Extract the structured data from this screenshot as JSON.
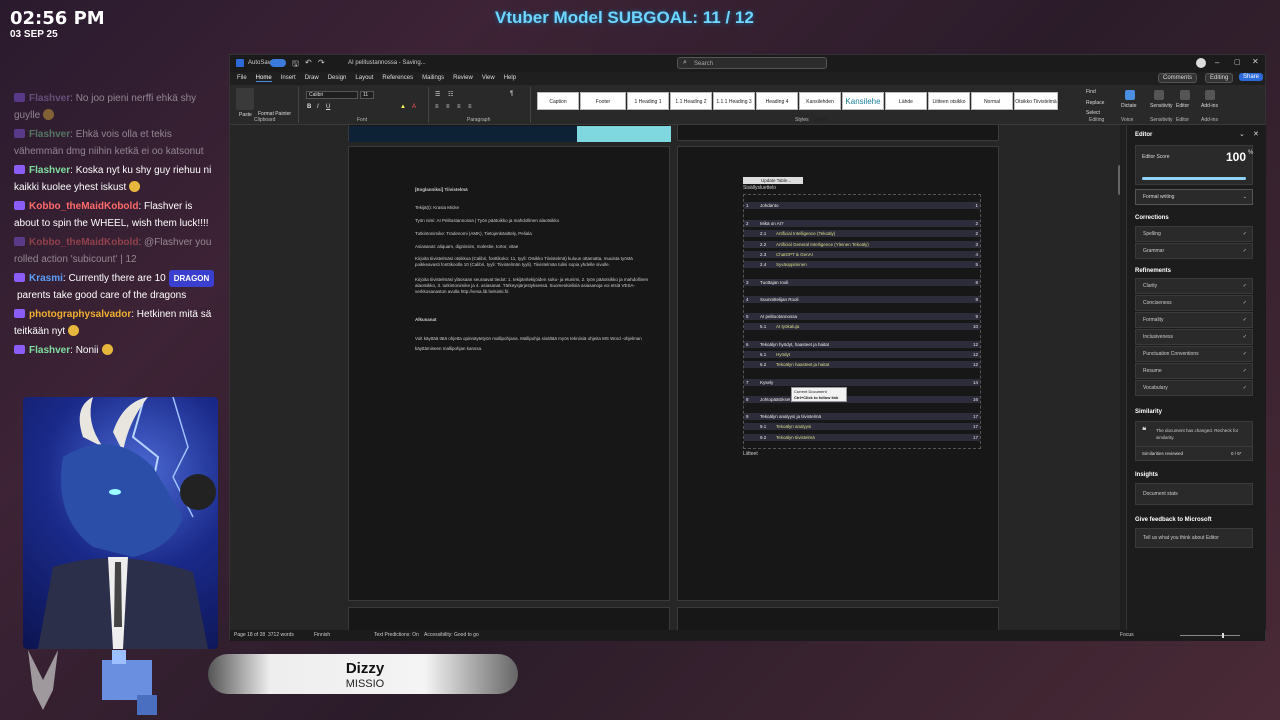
{
  "overlay": {
    "clock": "02:56 PM",
    "date": "03 SEP 25",
    "subgoal": "Vtuber Model SUBGOAL: 11 / 12",
    "nameplate_name": "Dizzy",
    "nameplate_sub": "MISSIO"
  },
  "chat": [
    {
      "user": "Flashver",
      "color": "#a58cd6",
      "text": ": No joo pieni nerffi ehkä shy guylle",
      "faded": true
    },
    {
      "user": "Flashver",
      "color": "#7fe0a0",
      "text": ": Ehkä vois olla et tekis vähemmän dmg niihin ketkä ei oo katsonut",
      "faded": true
    },
    {
      "user": "Flashver",
      "color": "#7fe0a0",
      "text": ": Koska nyt ku shy guy riehuu ni kaikki kuolee yhest iskust"
    },
    {
      "user": "Kobbo_theMaidKobold",
      "color": "#ff6a6a",
      "text": ": Flashver is about to spin the WHEEL, wish them luck!!!!"
    },
    {
      "user": "Kobbo_theMaidKobold",
      "color": "#ff6a6a",
      "text": ": @Flashver you rolled action 'subicount' | 12",
      "faded": true
    },
    {
      "user": "Krasmi",
      "color": "#5aa0ff",
      "text": ": Currently there are 10",
      "badge": "DRAGON",
      "text2": "parents",
      "text3": "take good care of the dragons"
    },
    {
      "user": "photographysalvador",
      "color": "#f0b030",
      "text": ": Hetkinen mitä sä teitkään nyt"
    },
    {
      "user": "Flashver",
      "color": "#7fe0a0",
      "text": ": Nonii"
    }
  ],
  "word": {
    "title": "AI pelitustannossa - Saving...",
    "autosave": "AutoSave",
    "search_placeholder": "Search",
    "menu": [
      "File",
      "Home",
      "Insert",
      "Draw",
      "Design",
      "Layout",
      "References",
      "Mailings",
      "Review",
      "View",
      "Help"
    ],
    "comments": "Comments",
    "editing": "Editing",
    "share": "Share",
    "clipboard": {
      "paste": "Paste",
      "format_painter": "Format Painter",
      "label": "Clipboard"
    },
    "font": {
      "name": "Calibri",
      "size": "11",
      "label": "Font"
    },
    "paragraph_label": "Paragraph",
    "styles_label": "Styles",
    "styles": [
      "Caption",
      "Footer",
      "1 Heading 1",
      "1.1 Heading 2",
      "1.1.1 Heading 3",
      "Heading 4",
      "Kansilehden Otsikko",
      "Kansilehe",
      "Lähde",
      "Liitteen otsikko",
      "Normal",
      "Otsikko Tiivistelmä"
    ],
    "editing_group": {
      "find": "Find",
      "replace": "Replace",
      "select": "Select",
      "label": "Editing"
    },
    "ribbon_right": [
      "Dictate",
      "Sensitivity",
      "Editor",
      "Add-ins"
    ],
    "ribbon_right_labels": [
      "Voice",
      "Sensitivity",
      "Editor",
      "Add-ins"
    ],
    "page1": {
      "heading": "[Englanniksi] Tiivistelmä",
      "authors": "Tekijä(t): Krasia Micke",
      "title_line": "Työn nimi: AI Pelitustannossa | Työn päätoikko ja mahdollinen alaotsikko",
      "degree": "Tutkintonimike: Tradenomi (AMK), Tietojenkäsittely, Peliala",
      "keywords": "Asiasanat: aliquam, dignissim, molestie, tortor, vitae",
      "para1": "Kirjoita tiivistelmäsi otsikkoa (Calibri, fonttikoko: 11, tyyli: Otsikko Tiivistelmä) kuluun ottamatta, muuista työstä poikkeavasti fonttikoolla 10 (Calibri, tyyli: Tiivistelmän tyyli). Tiivistelmän tulisi sopia yhdelle sivulle.",
      "para2": "Kirjoita tiivistelmäsi yläosaan seuraavat tiedot: 1. tekijän/tekijöiden suku- ja etunimi, 2. työn pääotsikko ja mahdollinen alaotsikko, 3. tutkintonimike ja 4. asiasanat. Tärkeysjärjestyksessä. Suomenkielisiä asiasanoja voi etsiä VESA-verkkosanaston avulla http://vesa.lib.helsinki.fi/.",
      "section": "Alkusanat",
      "para3": "Voit käyttää tätä ohjetta opinnäytetyön mallipohjana. Mallipohja sisältää myös tekniisiä ohjeita MS Word -ohjelman käyttämiseen mallipohjan kanssa."
    },
    "page2": {
      "update_btn": "Update Table...",
      "toc_title": "Sisällysluettelo",
      "toc": [
        {
          "n": "1",
          "t": "Johdanto",
          "p": "1"
        },
        {
          "n": "2",
          "t": "Mikä on AI?",
          "p": "2"
        },
        {
          "n": "2.1",
          "t": "Artificial Intelligence (Tekoäly)",
          "p": "2"
        },
        {
          "n": "2.2",
          "t": "Artificial General Intelligence (Yleinen Tekoäly)",
          "p": "3"
        },
        {
          "n": "2.3",
          "t": "ChatGPT & GenAI",
          "p": "4"
        },
        {
          "n": "2.4",
          "t": "Syväoppiminen",
          "p": "5"
        },
        {
          "n": "3",
          "t": "Tuottajan rooli",
          "p": "8"
        },
        {
          "n": "4",
          "t": "Suunnittelijan Rooli",
          "p": "8"
        },
        {
          "n": "5",
          "t": "AI pelituotannossa",
          "p": "9"
        },
        {
          "n": "5.1",
          "t": "AI työkaluja",
          "p": "10"
        },
        {
          "n": "6",
          "t": "Tekoälyn hyödyt, haasteet ja haitat",
          "p": "12"
        },
        {
          "n": "6.1",
          "t": "Hyödyt",
          "p": "12"
        },
        {
          "n": "6.2",
          "t": "Tekoälyn haasteet ja haitat",
          "p": "12"
        },
        {
          "n": "7",
          "t": "Kysely",
          "p": "14"
        },
        {
          "n": "8",
          "t": "Johtopäätökset",
          "p": "16"
        },
        {
          "n": "9",
          "t": "Tekoälyn analyysi ja tiivistelmä",
          "p": "17"
        },
        {
          "n": "9.1",
          "t": "Tekoälyn analyysi",
          "p": "17"
        },
        {
          "n": "9.2",
          "t": "Tekoälyn tiivistelmä",
          "p": "17"
        }
      ],
      "tooltip_title": "Current Document",
      "tooltip_text": "Ctrl+Click to follow link",
      "footer": "Liitteet"
    },
    "editor": {
      "title": "Editor",
      "score_label": "Editor Score",
      "score": "100",
      "score_unit": "%",
      "formal_writing": "Formal writing",
      "corrections": "Corrections",
      "corrections_items": [
        "Spelling",
        "Grammar"
      ],
      "refinements": "Refinements",
      "refinement_items": [
        "Clarity",
        "Conciseness",
        "Formality",
        "Inclusiveness",
        "Punctuation Conventions",
        "Resume",
        "Vocabulary"
      ],
      "similarity": "Similarity",
      "similarity_msg": "The document has changed. Recheck for similarity.",
      "similarities_reviewed": "Similarities reviewed",
      "similarities_count": "0 / 5*",
      "insights": "Insights",
      "document_stats": "Document stats",
      "feedback": "Give feedback to Microsoft",
      "feedback_link": "Tell us what you think about Editor"
    },
    "status": {
      "page": "Page 18 of 28",
      "words": "3712 words",
      "language": "Finnish",
      "predictions": "Text Predictions: On",
      "accessibility": "Accessibility: Good to go",
      "focus": "Focus"
    }
  }
}
